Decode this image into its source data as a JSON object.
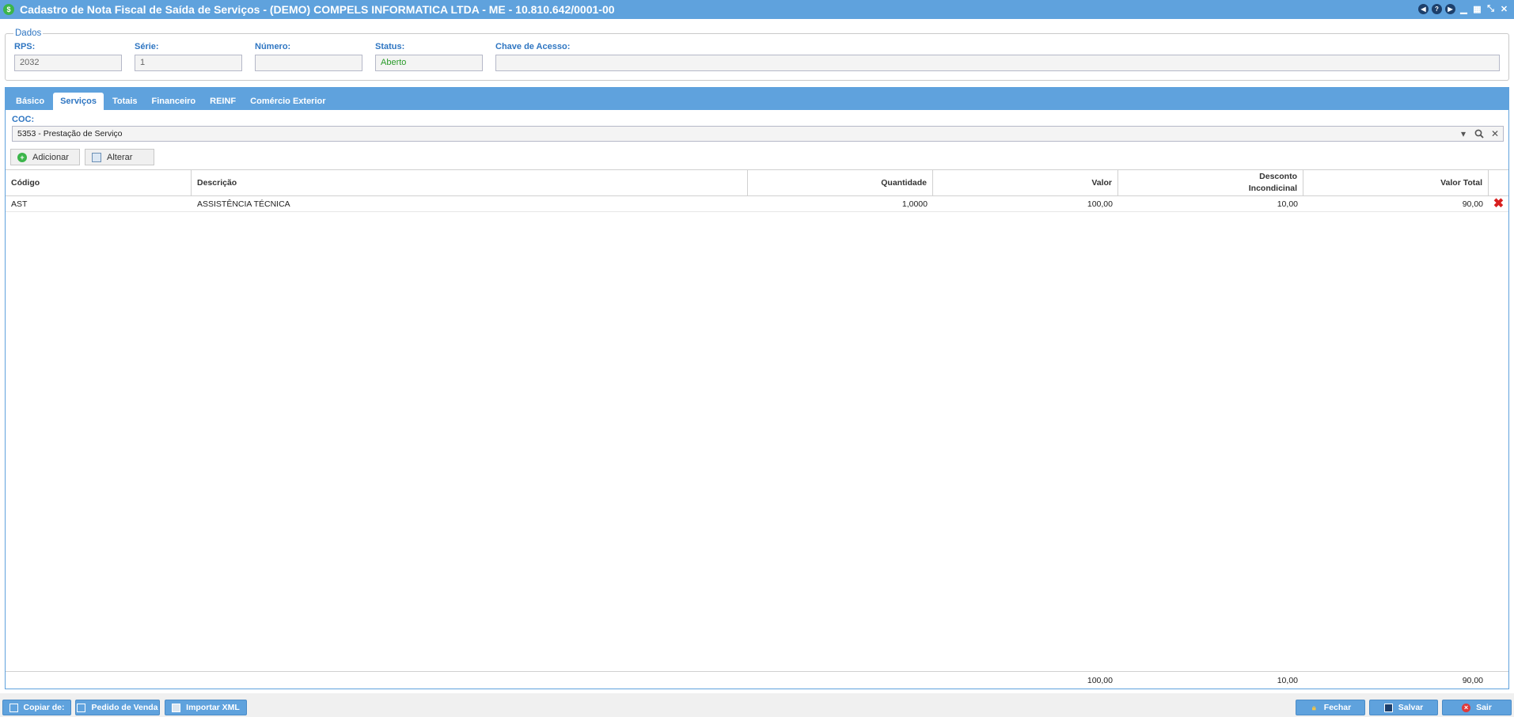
{
  "window": {
    "title": "Cadastro de Nota Fiscal de Saída de Serviços - (DEMO) COMPELS INFORMATICA LTDA - ME - 10.810.642/0001-00"
  },
  "dados": {
    "legend": "Dados",
    "rps_label": "RPS:",
    "rps_value": "2032",
    "serie_label": "Série:",
    "serie_value": "1",
    "numero_label": "Número:",
    "numero_value": "",
    "status_label": "Status:",
    "status_value": "Aberto",
    "chave_label": "Chave de Acesso:",
    "chave_value": ""
  },
  "tabs": [
    {
      "label": "Básico"
    },
    {
      "label": "Serviços"
    },
    {
      "label": "Totais"
    },
    {
      "label": "Financeiro"
    },
    {
      "label": "REINF"
    },
    {
      "label": "Comércio Exterior"
    }
  ],
  "services": {
    "coc_label": "COC:",
    "coc_value": "5353 - Prestação de Serviço",
    "add_label": "Adicionar",
    "edit_label": "Alterar",
    "columns": {
      "codigo": "Código",
      "descricao": "Descrição",
      "quantidade": "Quantidade",
      "valor": "Valor",
      "desconto_l1": "Desconto",
      "desconto_l2": "Incondicinal",
      "valor_total": "Valor Total"
    },
    "rows": [
      {
        "codigo": "AST",
        "descricao": "ASSISTÊNCIA TÉCNICA",
        "quantidade": "1,0000",
        "valor": "100,00",
        "desconto": "10,00",
        "valor_total": "90,00"
      }
    ],
    "totals": {
      "valor": "100,00",
      "desconto": "10,00",
      "valor_total": "90,00"
    }
  },
  "bottom": {
    "copiar": "Copiar de:",
    "pedido": "Pedido de Venda",
    "importar": "Importar XML",
    "fechar": "Fechar",
    "salvar": "Salvar",
    "sair": "Sair"
  },
  "colors": {
    "header_blue": "#5fa2dd",
    "label_blue": "#2f76c2",
    "status_green": "#2a9b2a",
    "delete_red": "#d81f1f"
  }
}
